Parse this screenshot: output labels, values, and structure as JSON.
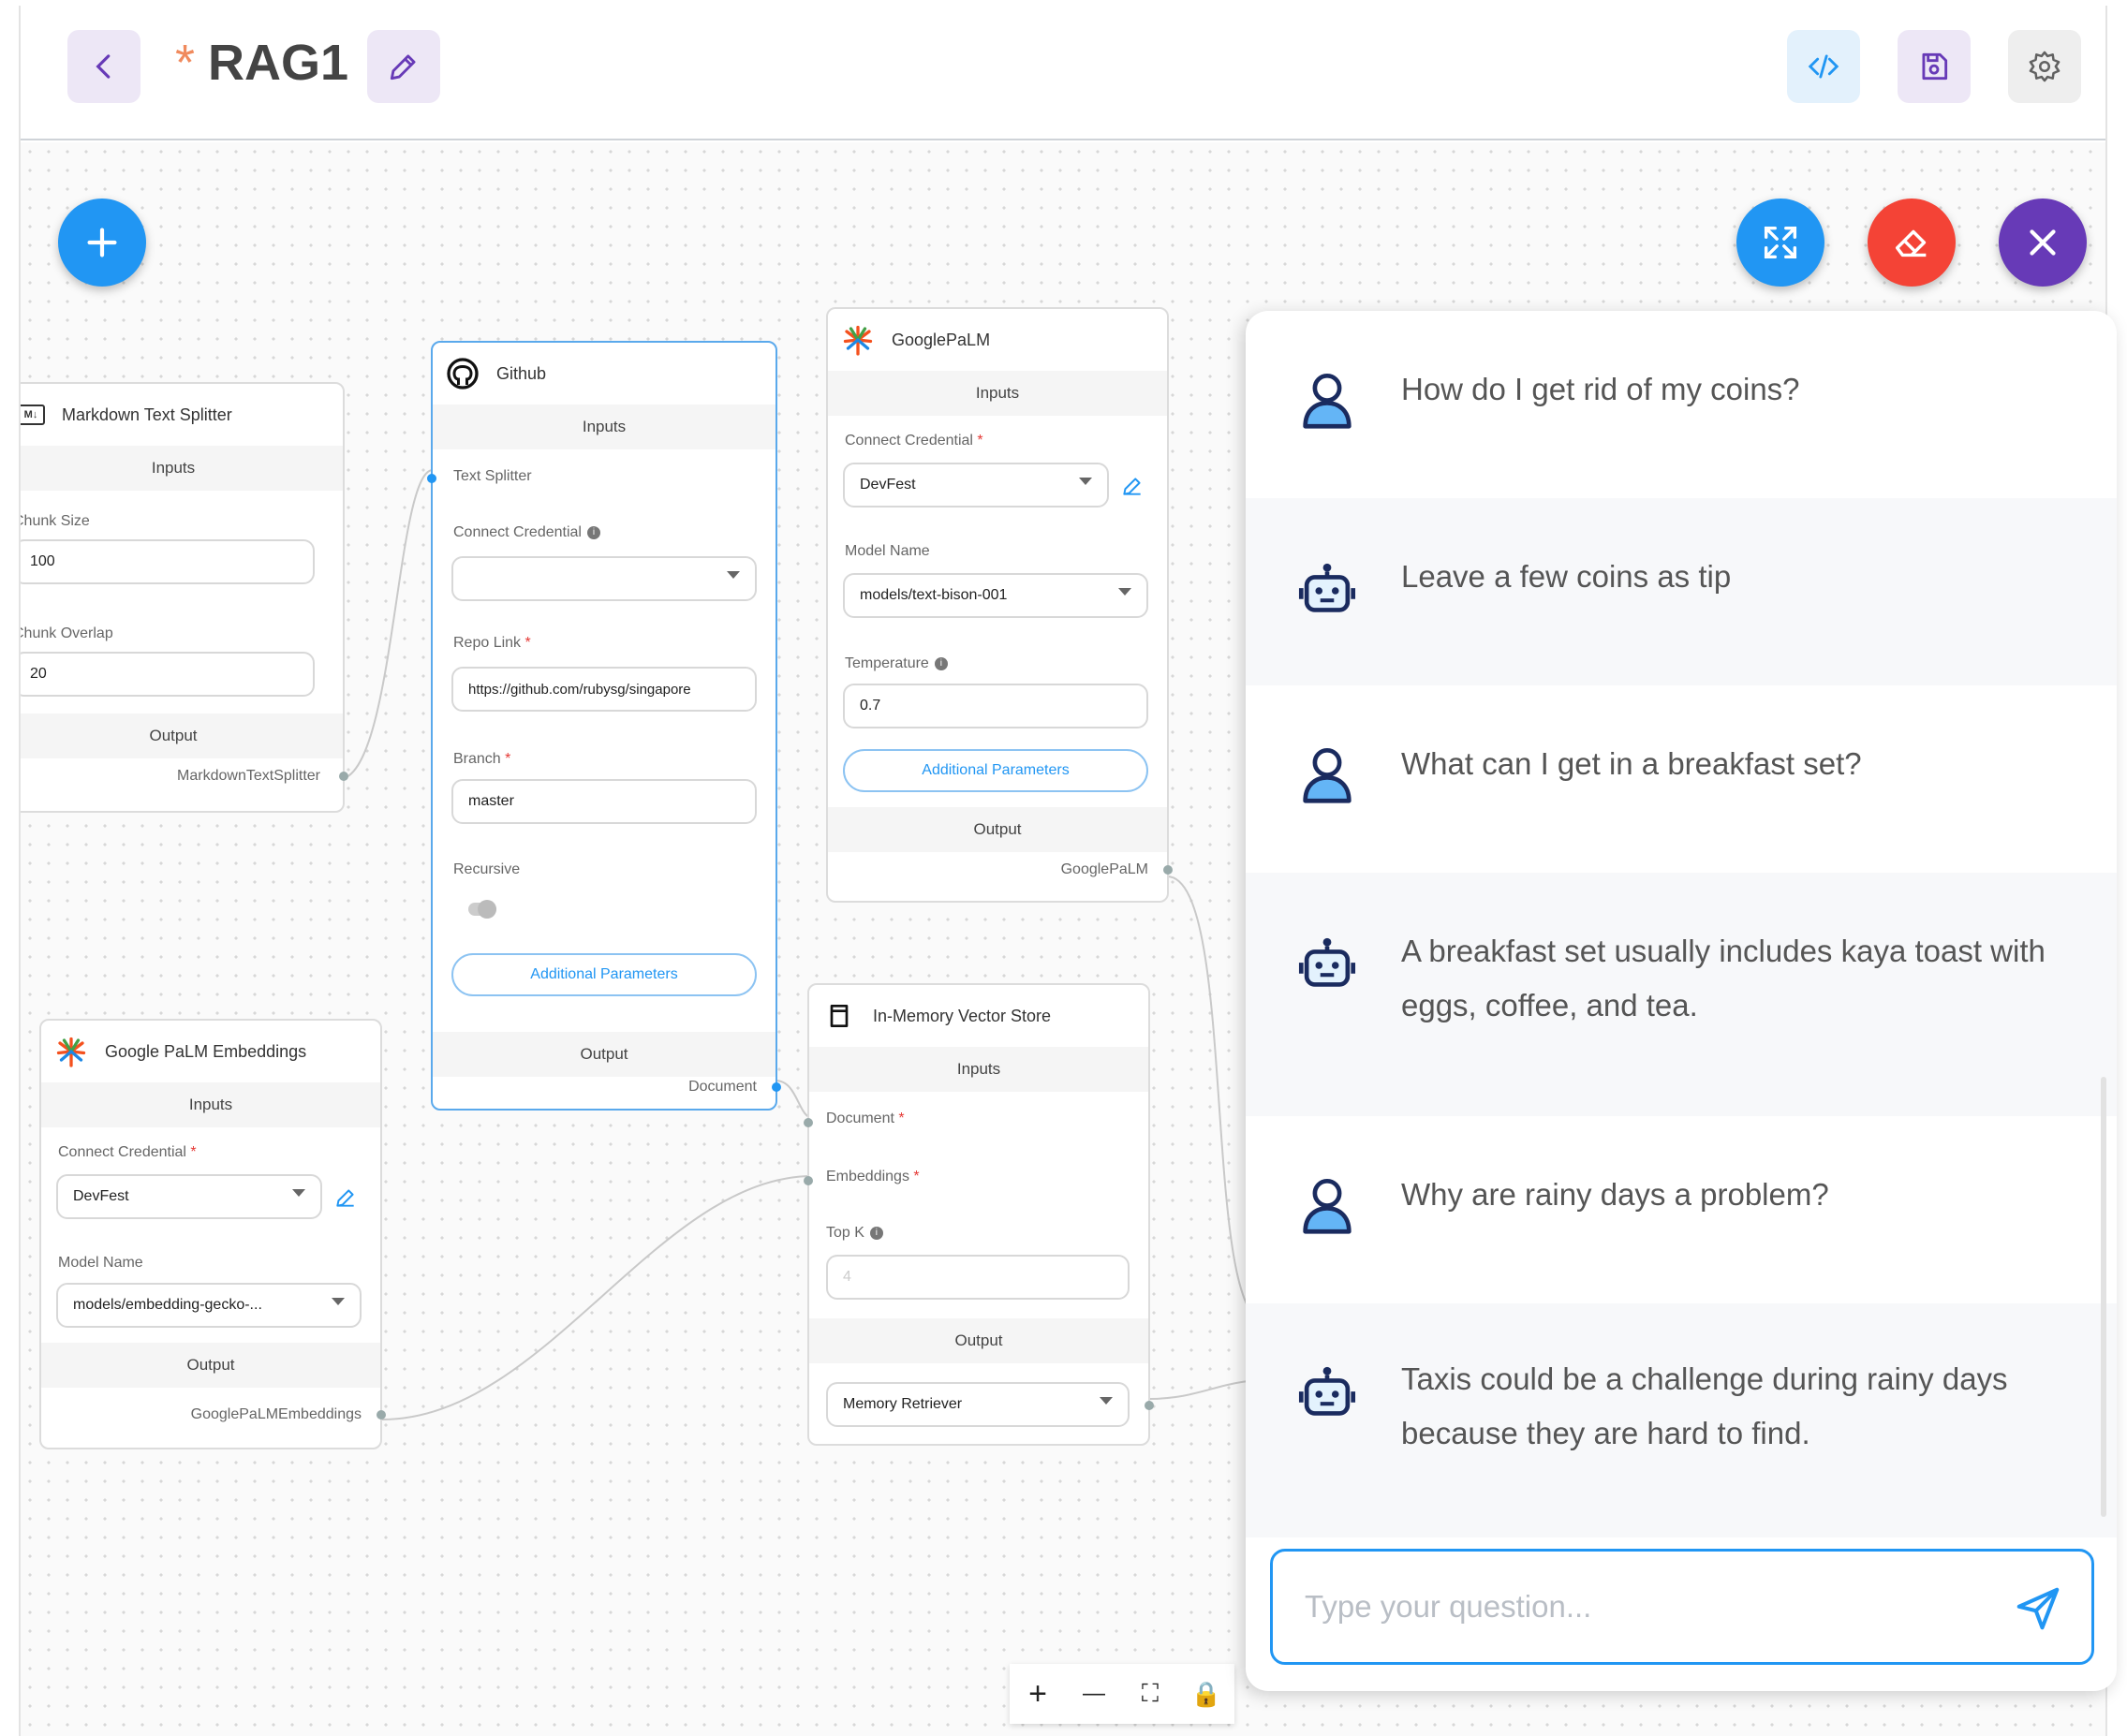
{
  "header": {
    "back_icon": "chevron-left-icon",
    "unsaved_marker": "*",
    "title": "RAG1",
    "edit_icon": "pencil-icon",
    "actions": [
      {
        "name": "code-embed-button",
        "icon": "code-icon",
        "bg": "#e3f1fc",
        "color": "#2196f3"
      },
      {
        "name": "save-button",
        "icon": "save-icon",
        "bg": "#ede7f6",
        "color": "#673ab7"
      },
      {
        "name": "settings-button",
        "icon": "gear-icon",
        "bg": "#eeeeee",
        "color": "#616161"
      }
    ]
  },
  "colors": {
    "accent_blue": "#2196f3",
    "accent_red": "#f44336",
    "accent_purple": "#673ab7",
    "edge": "#c9c9c9"
  },
  "nodes": {
    "markdown": {
      "title": "Markdown Text Splitter",
      "inputs_label": "Inputs",
      "chunk_size_label": "Chunk Size",
      "chunk_size_value": "100",
      "chunk_overlap_label": "Chunk Overlap",
      "chunk_overlap_value": "20",
      "output_label": "Output",
      "output_value": "MarkdownTextSplitter"
    },
    "github": {
      "title": "Github",
      "inputs_label": "Inputs",
      "text_splitter_label": "Text Splitter",
      "connect_credential_label": "Connect Credential",
      "connect_credential_value": "",
      "repo_link_label": "Repo Link",
      "repo_link_value": "https://github.com/rubysg/singapore",
      "branch_label": "Branch",
      "branch_value": "master",
      "recursive_label": "Recursive",
      "additional_params": "Additional Parameters",
      "output_label": "Output",
      "output_value": "Document"
    },
    "googlepalm": {
      "title": "GooglePaLM",
      "inputs_label": "Inputs",
      "connect_credential_label": "Connect Credential",
      "connect_credential_value": "DevFest",
      "model_name_label": "Model Name",
      "model_name_value": "models/text-bison-001",
      "temperature_label": "Temperature",
      "temperature_value": "0.7",
      "additional_params": "Additional Parameters",
      "output_label": "Output",
      "output_value": "GooglePaLM"
    },
    "embeddings": {
      "title": "Google PaLM Embeddings",
      "inputs_label": "Inputs",
      "connect_credential_label": "Connect Credential",
      "connect_credential_value": "DevFest",
      "model_name_label": "Model Name",
      "model_name_value": "models/embedding-gecko-...",
      "output_label": "Output",
      "output_value": "GooglePaLMEmbeddings"
    },
    "vectorstore": {
      "title": "In-Memory Vector Store",
      "inputs_label": "Inputs",
      "document_label": "Document",
      "embeddings_label": "Embeddings",
      "topk_label": "Top K",
      "topk_placeholder": "4",
      "output_label": "Output",
      "output_value": "Memory Retriever"
    }
  },
  "chat": {
    "messages": [
      {
        "role": "user",
        "text": "How do I get rid of my coins?"
      },
      {
        "role": "bot",
        "text": "Leave a few coins as tip"
      },
      {
        "role": "user",
        "text": "What can I get in a breakfast set?"
      },
      {
        "role": "bot",
        "text": "A breakfast set usually includes kaya toast with eggs, coffee, and tea."
      },
      {
        "role": "user",
        "text": "Why are rainy days a problem?"
      },
      {
        "role": "bot",
        "text": "Taxis could be a challenge during rainy days because they are hard to find."
      }
    ],
    "input_placeholder": "Type your question..."
  },
  "zoom_controls": {
    "zoom_in": "+",
    "zoom_out": "—",
    "fit": "⛶",
    "lock": "🔒"
  }
}
